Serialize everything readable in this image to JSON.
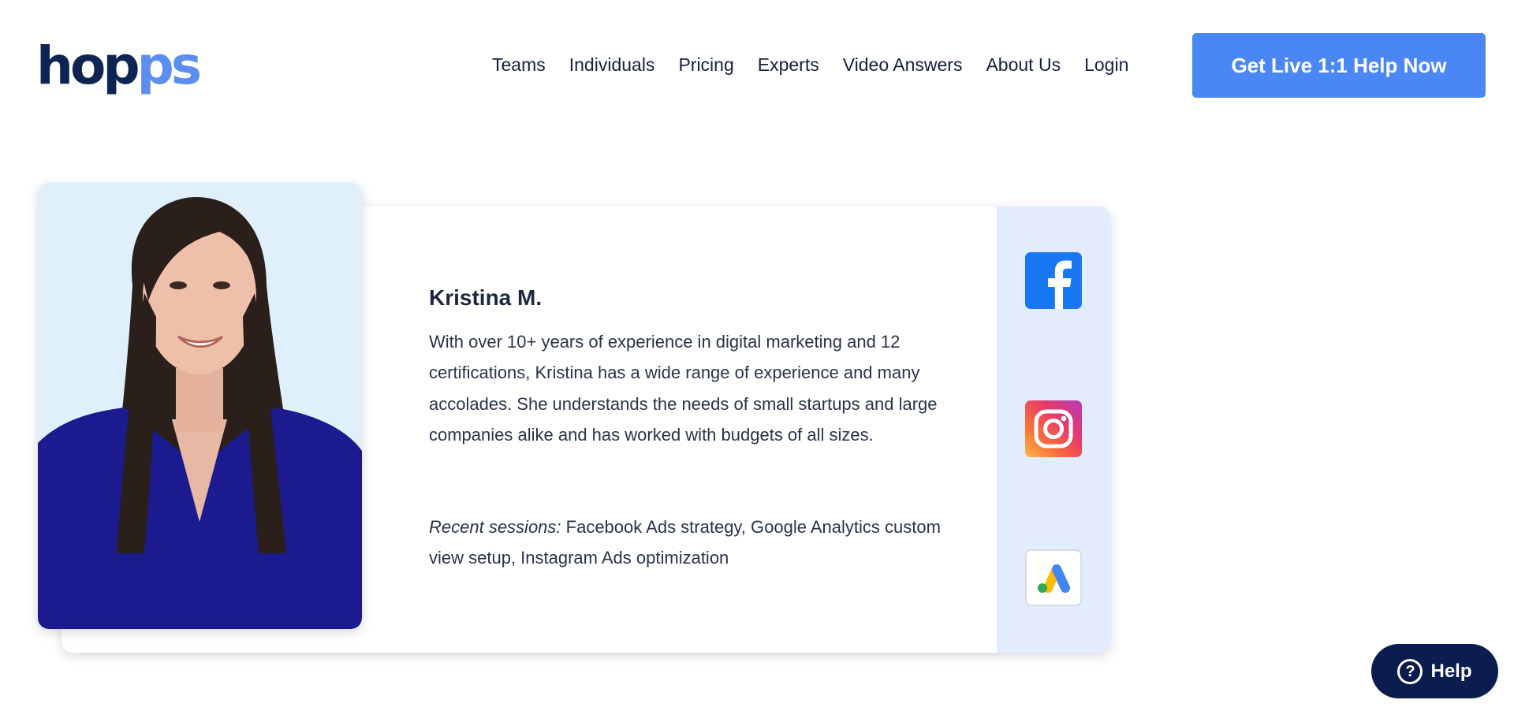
{
  "header": {
    "logo": {
      "part1": "hop",
      "part2": "ps"
    },
    "nav": [
      {
        "label": "Teams"
      },
      {
        "label": "Individuals"
      },
      {
        "label": "Pricing"
      },
      {
        "label": "Experts"
      },
      {
        "label": "Video Answers"
      },
      {
        "label": "About Us"
      },
      {
        "label": "Login"
      }
    ],
    "cta_label": "Get Live 1:1 Help Now"
  },
  "expert": {
    "name": "Kristina M.",
    "bio": "With over 10+ years of experience in digital marketing and 12 certifications, Kristina has a wide range of experience and many accolades. She understands the needs of small startups and large companies alike and has worked with budgets of all sizes.",
    "sessions_label": "Recent sessions:",
    "sessions_text": " Facebook Ads strategy, Google Analytics custom view setup, Instagram Ads optimization",
    "platforms": [
      "facebook-icon",
      "instagram-icon",
      "google-ads-icon"
    ]
  },
  "help_button": {
    "label": "Help",
    "icon": "question-circle-icon"
  },
  "colors": {
    "brand_dark": "#0e2452",
    "brand_light": "#5b8ef0",
    "cta": "#4a87f5",
    "sidebar": "#e2ecfc",
    "help_bg": "#0b1d4f"
  }
}
